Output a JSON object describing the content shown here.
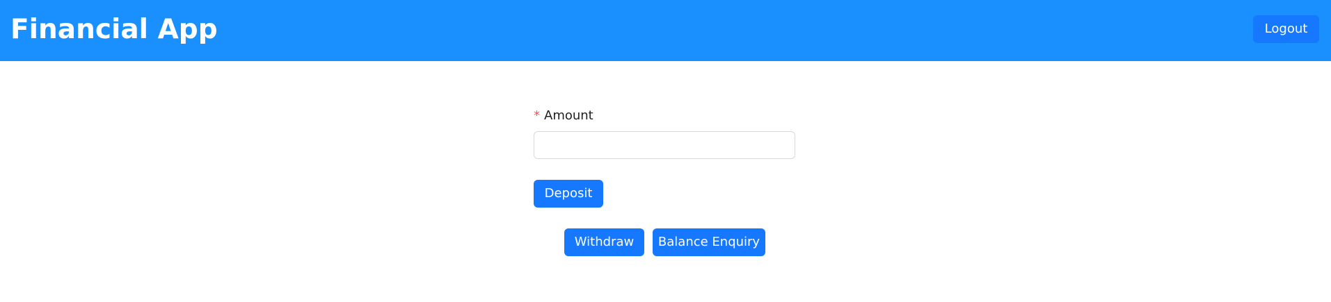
{
  "header": {
    "title": "Financial App",
    "logout_label": "Logout"
  },
  "form": {
    "required_mark": "*",
    "amount_label": "Amount",
    "amount_value": "",
    "amount_placeholder": ""
  },
  "actions": {
    "deposit_label": "Deposit",
    "withdraw_label": "Withdraw",
    "balance_label": "Balance Enquiry"
  },
  "colors": {
    "header_bg": "#1a90ff",
    "primary": "#1677ff",
    "required": "#ff4d4f"
  }
}
